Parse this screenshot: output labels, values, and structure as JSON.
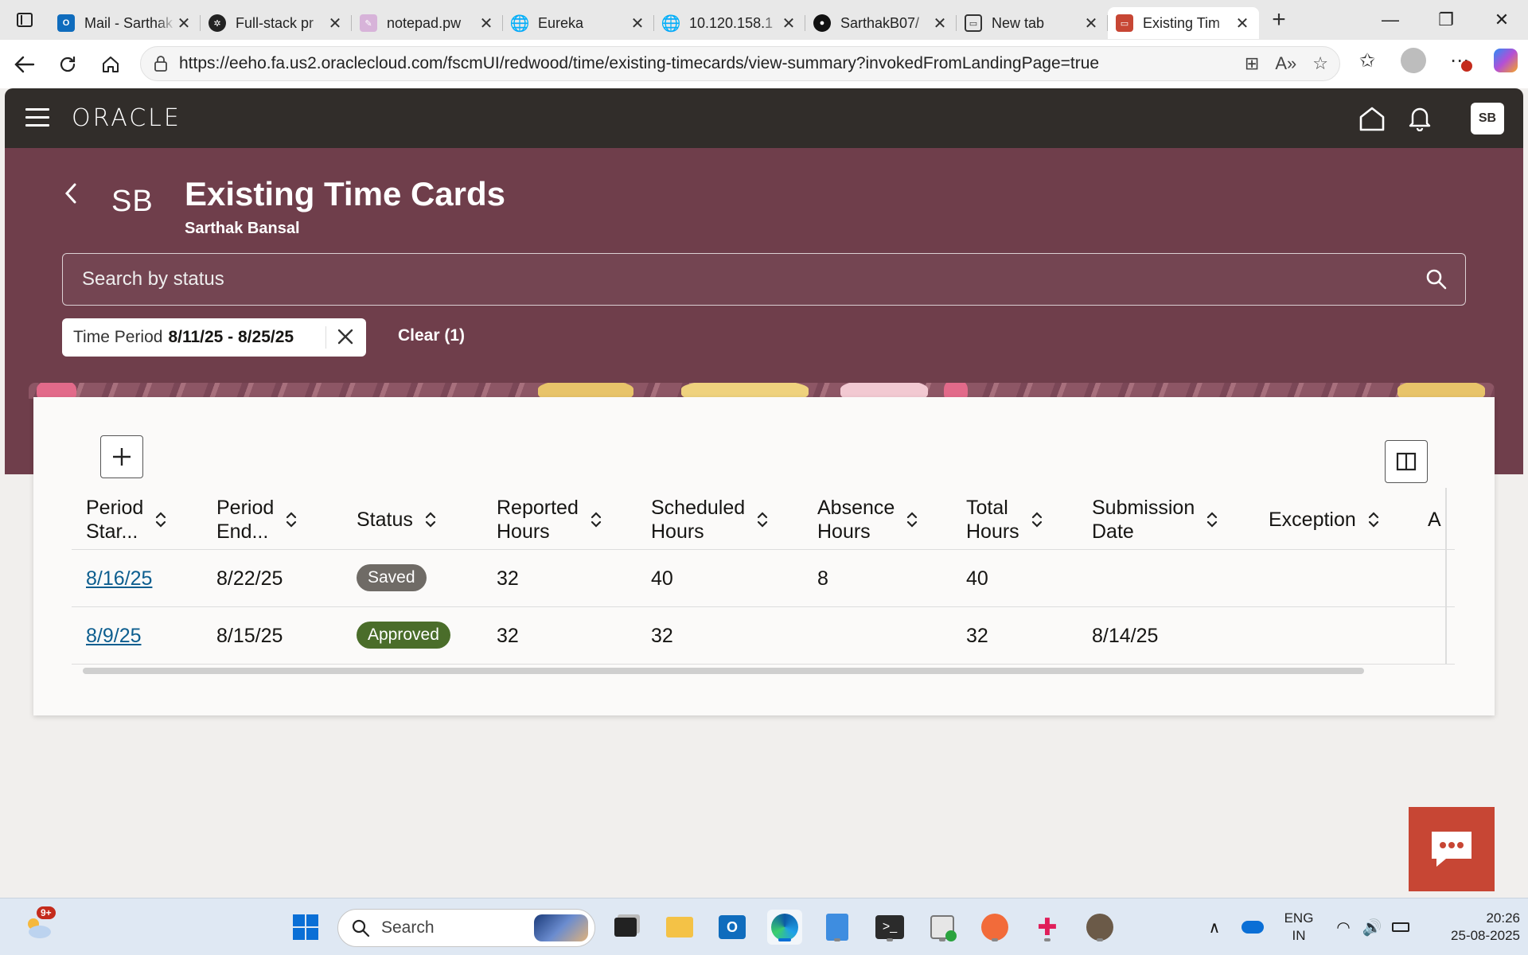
{
  "browser": {
    "tabs": [
      {
        "title": "Mail - Sarthak",
        "icon": "outlook-icon",
        "color": "#0f6cbd"
      },
      {
        "title": "Full-stack pr",
        "icon": "chatgpt-icon",
        "color": "#222222"
      },
      {
        "title": "notepad.pw",
        "icon": "notepad-icon",
        "color": "#c8a2c8"
      },
      {
        "title": "Eureka",
        "icon": "globe-icon",
        "color": "#444444"
      },
      {
        "title": "10.120.158.1",
        "icon": "globe-icon",
        "color": "#444444"
      },
      {
        "title": "SarthakB07/",
        "icon": "github-icon",
        "color": "#111111"
      },
      {
        "title": "New tab",
        "icon": "newtab-icon",
        "color": "#444444"
      },
      {
        "title": "Existing Tim",
        "icon": "oracle-icon",
        "color": "#c74634"
      }
    ],
    "url": "https://eeho.fa.us2.oraclecloud.com/fscmUI/redwood/time/existing-timecards/view-summary?invokedFromLandingPage=true"
  },
  "header": {
    "logo": "ORACLE",
    "user_initials": "SB"
  },
  "page": {
    "avatar": "SB",
    "title": "Existing Time Cards",
    "subtitle": "Sarthak Bansal",
    "search_placeholder": "Search by status",
    "filter_chip": {
      "label": "Time Period",
      "value": "8/11/25 - 8/25/25"
    },
    "clear_label": "Clear (1)"
  },
  "table": {
    "columns": [
      {
        "line1": "Period",
        "line2": "Star..."
      },
      {
        "line1": "Period",
        "line2": "End..."
      },
      {
        "line1": "Status",
        "line2": ""
      },
      {
        "line1": "Reported",
        "line2": "Hours"
      },
      {
        "line1": "Scheduled",
        "line2": "Hours"
      },
      {
        "line1": "Absence",
        "line2": "Hours"
      },
      {
        "line1": "Total",
        "line2": "Hours"
      },
      {
        "line1": "Submission",
        "line2": "Date"
      },
      {
        "line1": "Exception",
        "line2": ""
      },
      {
        "line1": "A",
        "line2": ""
      }
    ],
    "rows": [
      {
        "period_start": "8/16/25",
        "period_end": "8/22/25",
        "status": "Saved",
        "status_color": "#6f6b66",
        "reported": "32",
        "scheduled": "40",
        "absence": "8",
        "total": "40",
        "submission": "",
        "exception": ""
      },
      {
        "period_start": "8/9/25",
        "period_end": "8/15/25",
        "status": "Approved",
        "status_color": "#4a6d2a",
        "reported": "32",
        "scheduled": "32",
        "absence": "",
        "total": "32",
        "submission": "8/14/25",
        "exception": ""
      }
    ]
  },
  "taskbar": {
    "weather_badge": "9+",
    "search_placeholder": "Search",
    "lang_line1": "ENG",
    "lang_line2": "IN",
    "time": "20:26",
    "date": "25-08-2025"
  }
}
